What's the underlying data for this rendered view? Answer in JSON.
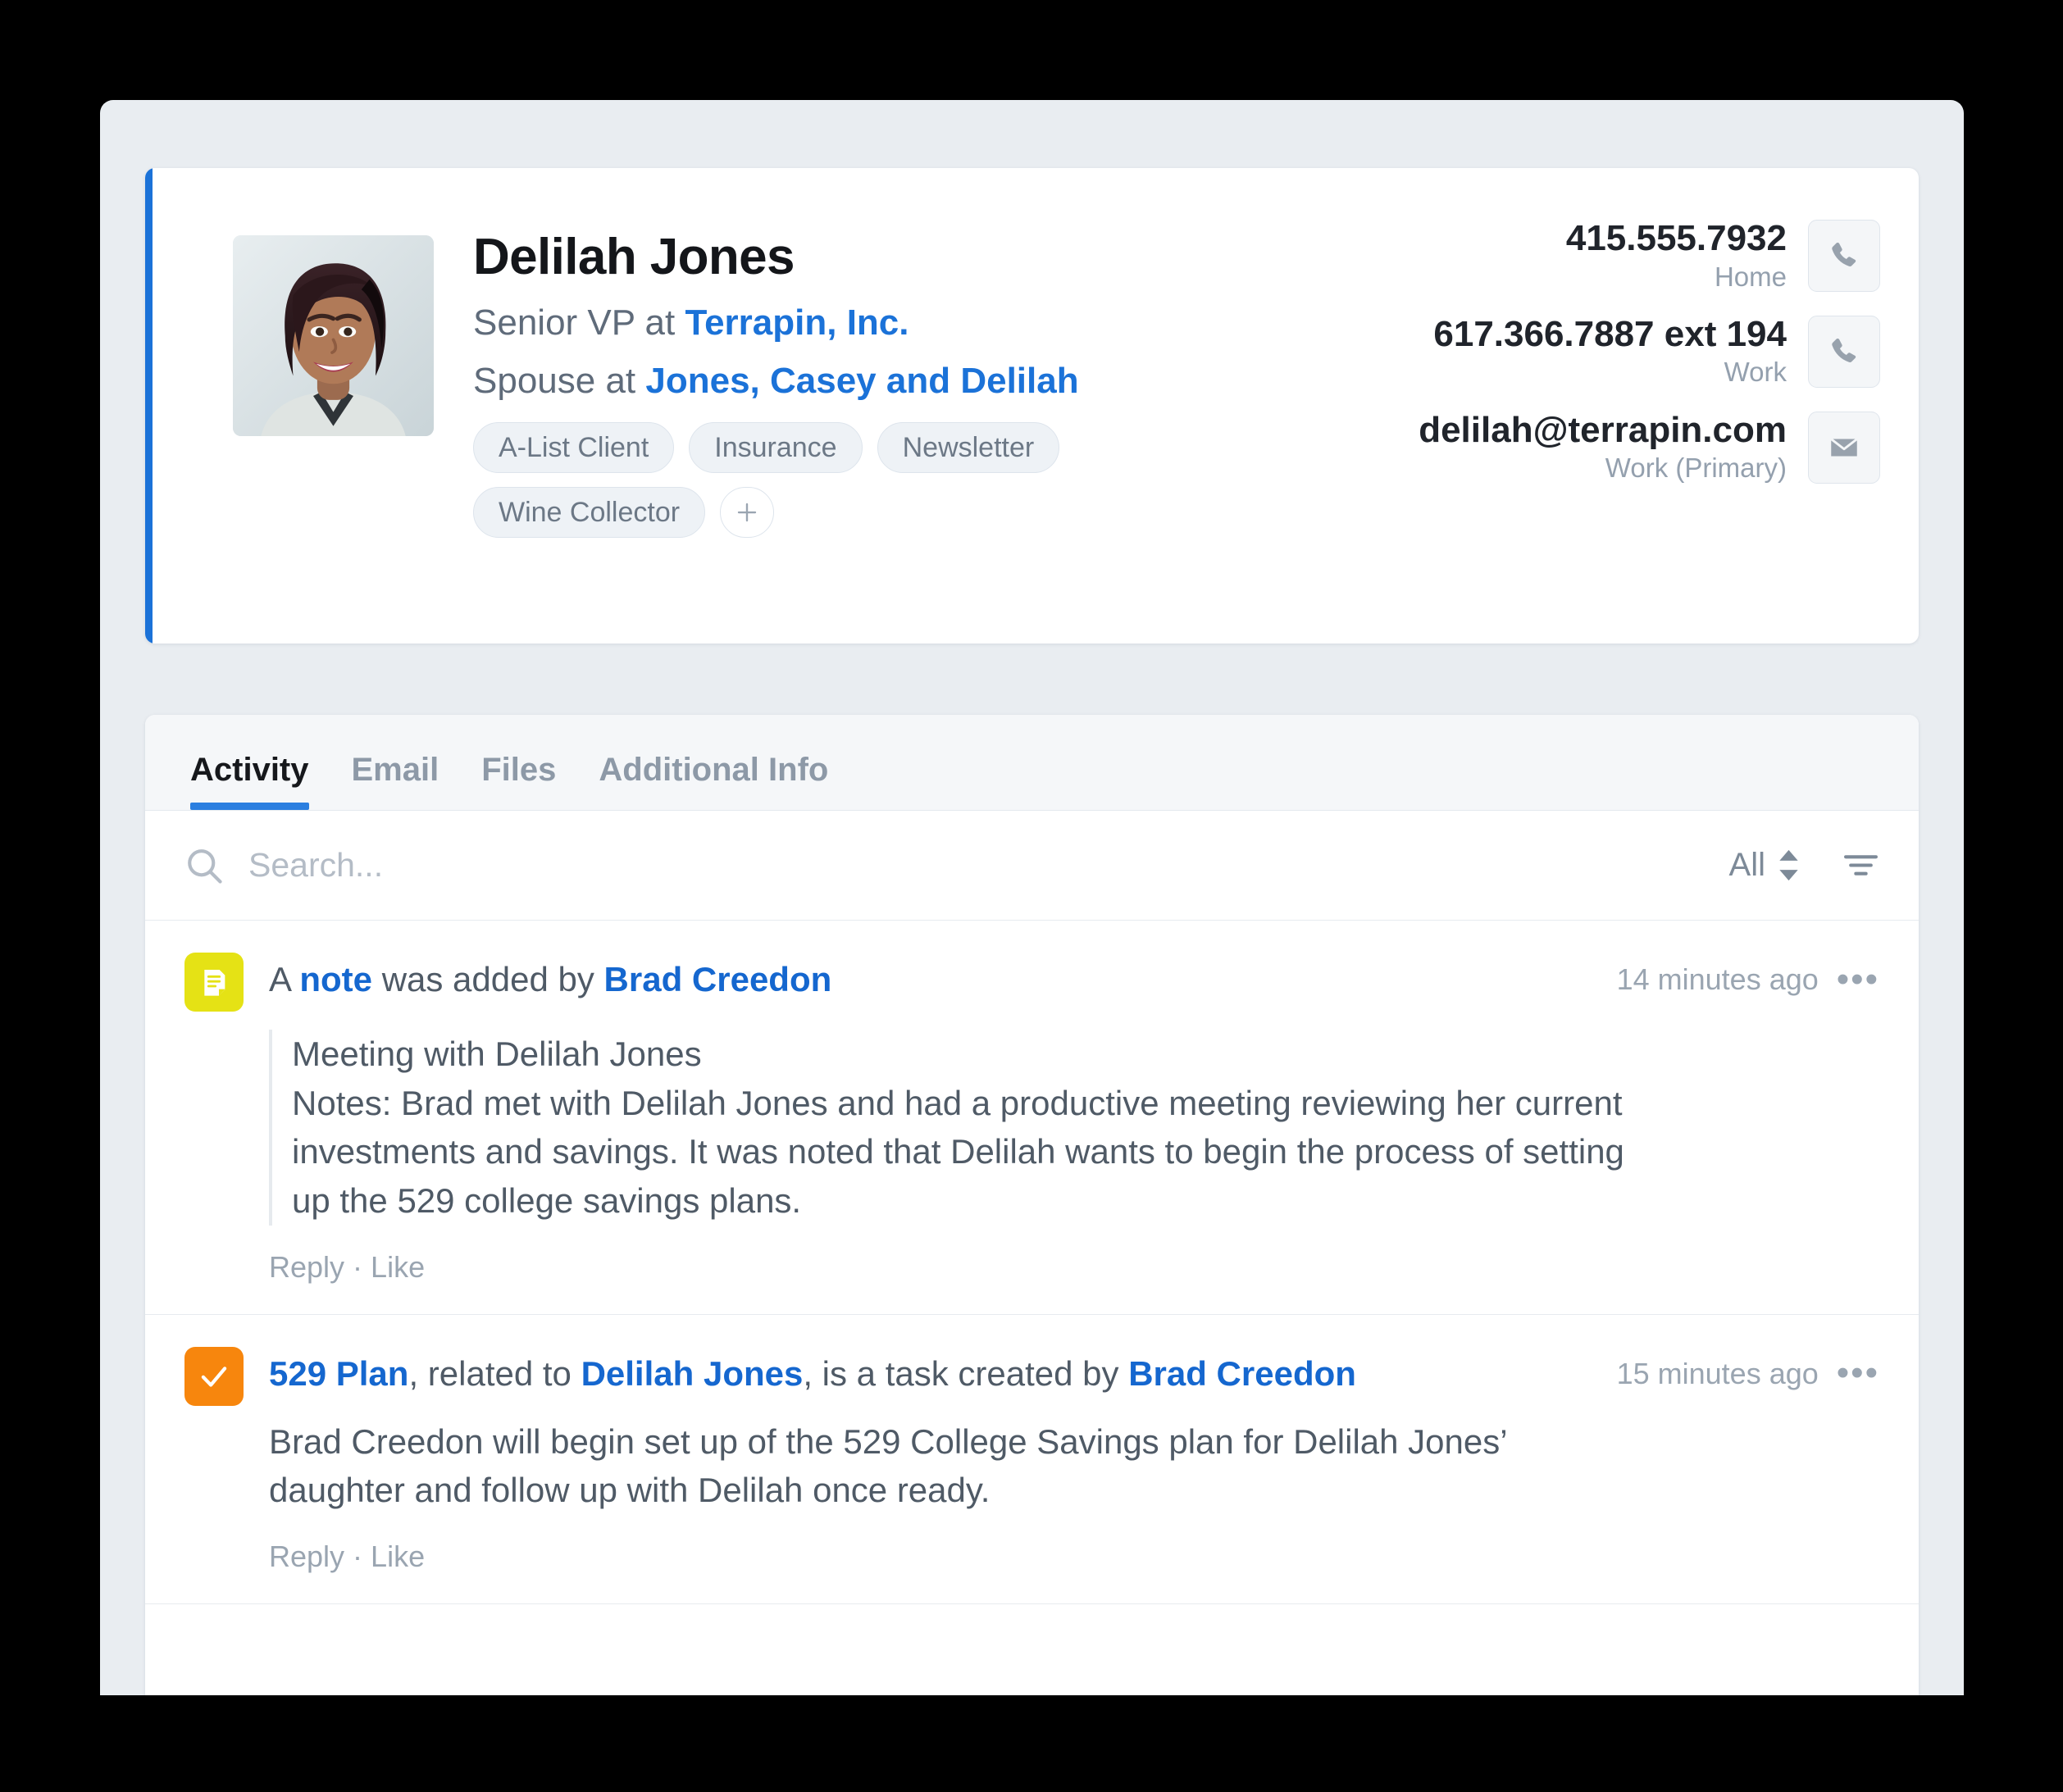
{
  "profile": {
    "name": "Delilah Jones",
    "avatar_alt": "avatar-photo",
    "affiliations": [
      {
        "prefix": "Senior VP at ",
        "link": "Terrapin, Inc."
      },
      {
        "prefix": "Spouse at ",
        "link": "Jones, Casey and Delilah"
      }
    ],
    "tags": [
      "A-List Client",
      "Insurance",
      "Newsletter",
      "Wine Collector"
    ],
    "add_tag_label": "+",
    "contact_methods": [
      {
        "value": "415.555.7932",
        "label": "Home",
        "icon": "phone-icon",
        "action": "call-home-button"
      },
      {
        "value": "617.366.7887 ext 194",
        "label": "Work",
        "icon": "phone-icon",
        "action": "call-work-button"
      },
      {
        "value": "delilah@terrapin.com",
        "label": "Work (Primary)",
        "icon": "mail-icon",
        "action": "email-button"
      }
    ]
  },
  "tabs": [
    {
      "label": "Activity",
      "active": true
    },
    {
      "label": "Email",
      "active": false
    },
    {
      "label": "Files",
      "active": false
    },
    {
      "label": "Additional Info",
      "active": false
    }
  ],
  "toolbar": {
    "search_placeholder": "Search...",
    "search_value": "",
    "search_icon": "search-icon",
    "sort_label": "All",
    "sort_icon": "sort-updown-icon",
    "filter_icon": "filter-icon"
  },
  "activity": [
    {
      "icon": "note-icon",
      "icon_color": "#e5e215",
      "headline": [
        {
          "text": "A ",
          "style": "plain"
        },
        {
          "text": "note",
          "style": "link"
        },
        {
          "text": " was added by ",
          "style": "plain"
        },
        {
          "text": "Brad Creedon",
          "style": "link"
        }
      ],
      "time": "14 minutes ago",
      "more_label": "•••",
      "body": "Meeting with Delilah Jones\nNotes: Brad met with Delilah Jones and had a productive meeting reviewing her current investments and savings. It was noted that Delilah wants to begin the process of setting up the 529 college savings plans.",
      "quoted": true,
      "actions": {
        "reply": "Reply",
        "separator": "·",
        "like": "Like"
      }
    },
    {
      "icon": "task-check-icon",
      "icon_color": "#f7860d",
      "headline": [
        {
          "text": "529 Plan",
          "style": "link"
        },
        {
          "text": ", related to ",
          "style": "plain"
        },
        {
          "text": "Delilah Jones",
          "style": "link"
        },
        {
          "text": ", is a task created by ",
          "style": "plain"
        },
        {
          "text": "Brad Creedon",
          "style": "link"
        }
      ],
      "time": "15 minutes ago",
      "more_label": "•••",
      "body": "Brad Creedon will begin set up of the 529 College Savings plan for Delilah Jones’ daughter and follow up with Delilah once ready.",
      "quoted": false,
      "actions": {
        "reply": "Reply",
        "separator": "·",
        "like": "Like"
      }
    }
  ],
  "colors": {
    "accent_blue": "#1b72d8",
    "link_blue": "#1567cf",
    "page_bg": "#e9edf1",
    "card_bg": "#ffffff",
    "note_yellow": "#e5e215",
    "task_orange": "#f7860d"
  }
}
